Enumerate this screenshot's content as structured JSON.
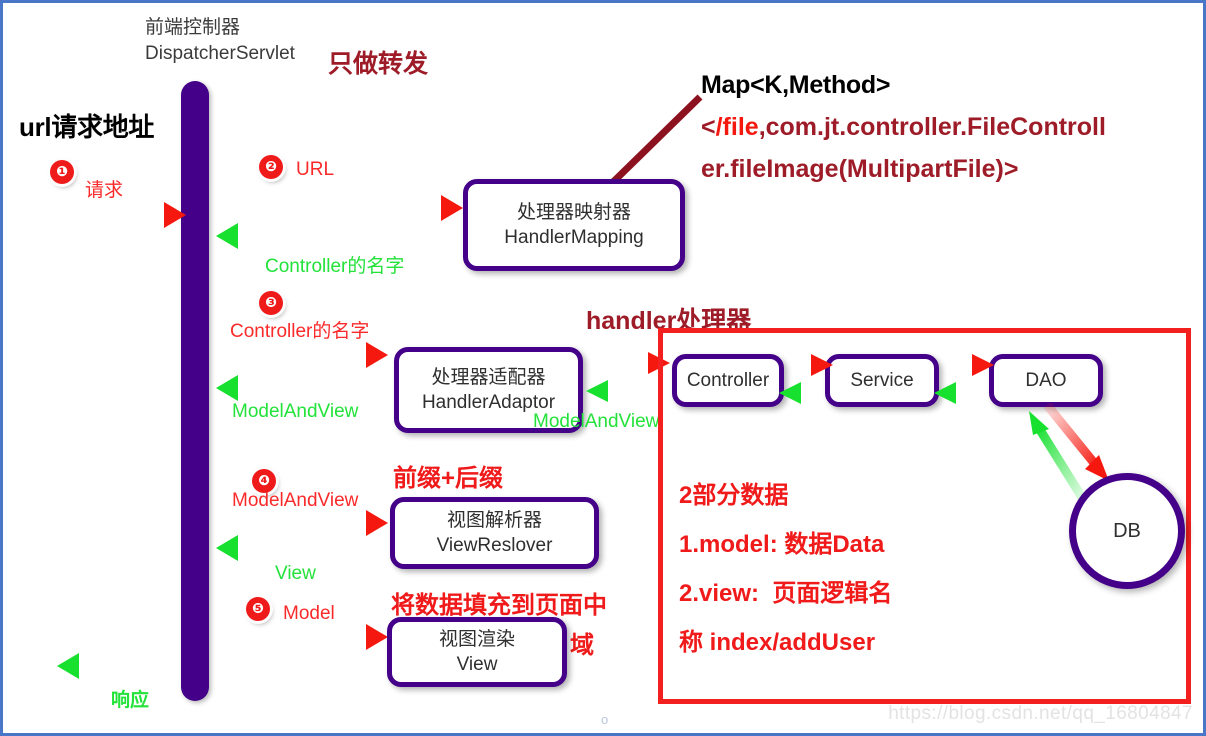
{
  "diagram": {
    "title_front_controller_cn": "前端控制器",
    "title_front_controller_en": "DispatcherServlet",
    "note_forward_only": "只做转发",
    "url_request_heading": "url请求地址",
    "handler_panel_heading": "handler处理器",
    "watermark": "https://blog.csdn.net/qq_16804847",
    "page_artifact": "o"
  },
  "map_callout": {
    "line1": "Map<K,Method>",
    "line2_prefix": "<",
    "line2_highlight": "/file",
    "line2_rest": ",com.jt.controller.FileControll",
    "line3": "er.fileImage(MultipartFile)>"
  },
  "steps": [
    {
      "number": "❶",
      "label": "请求"
    },
    {
      "number": "❷",
      "label": "URL"
    },
    {
      "number": "❸",
      "label": "Controller的名字"
    },
    {
      "number": "❹",
      "label": "ModelAndView"
    },
    {
      "number": "❺",
      "label": "Model"
    }
  ],
  "boxes": [
    {
      "name": "handler-mapping",
      "line_cn": "处理器映射器",
      "line_en": "HandlerMapping"
    },
    {
      "name": "handler-adaptor",
      "line_cn": "处理器适配器",
      "line_en": "HandlerAdaptor"
    },
    {
      "name": "view-resolver",
      "line_cn": "视图解析器",
      "line_en": "ViewReslover"
    },
    {
      "name": "view-render",
      "line_cn": "视图渲染",
      "line_en": "View"
    }
  ],
  "handler_chain": [
    {
      "name": "controller",
      "label": "Controller"
    },
    {
      "name": "service",
      "label": "Service"
    },
    {
      "name": "dao",
      "label": "DAO"
    }
  ],
  "database": {
    "label": "DB"
  },
  "return_labels": {
    "controller_name": "Controller的名字",
    "model_and_view_left": "ModelAndView",
    "model_and_view_right": "ModelAndView",
    "view": "View",
    "response": "响应"
  },
  "annotations": {
    "prefix_suffix": "前缀+后缀",
    "fill_page_line1": "将数据填充到页面中",
    "fill_page_line2": "域"
  },
  "panel_notes": {
    "line1": "2部分数据",
    "line2": "1.model: 数据Data",
    "line3": "2.view:  页面逻辑名",
    "line4": "称 index/addUser"
  },
  "colors": {
    "purple": "#440088",
    "red": "#f41f1f",
    "green": "#17e02f",
    "dark_red": "#9e1b28",
    "border_blue": "#4a76c8"
  }
}
